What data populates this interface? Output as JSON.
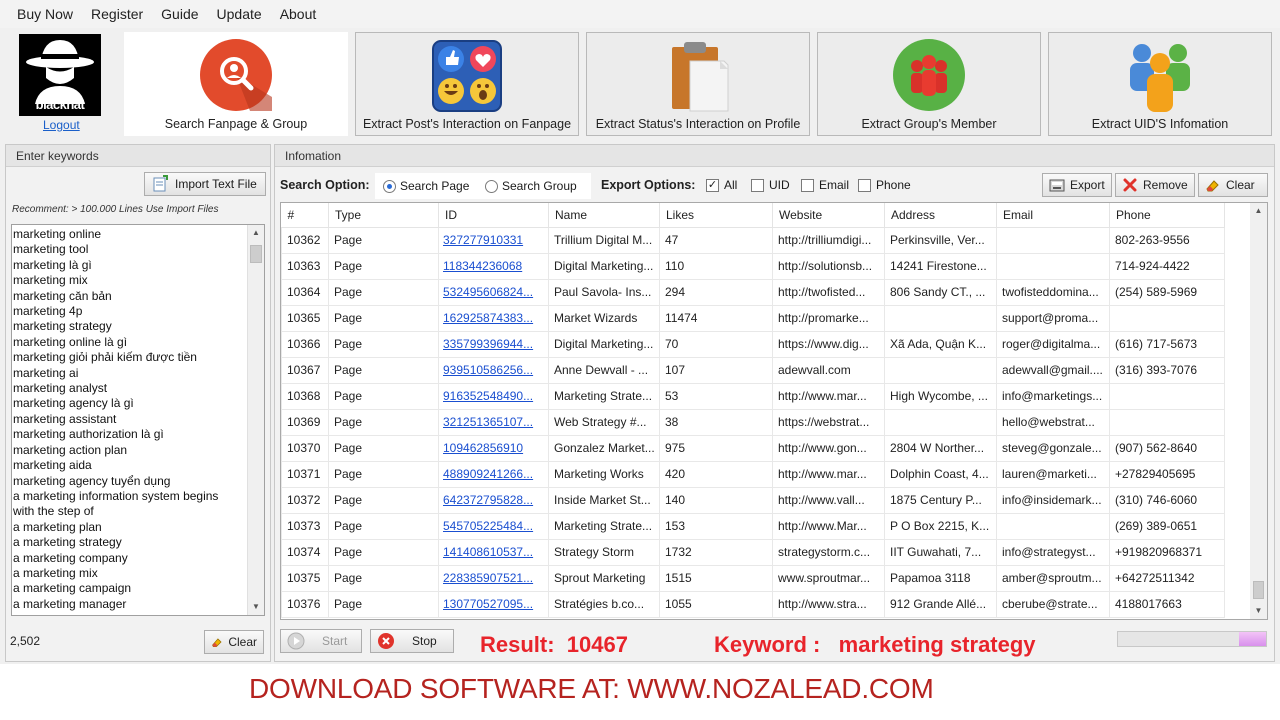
{
  "menu": [
    "Buy Now",
    "Register",
    "Guide",
    "Update",
    "About"
  ],
  "logo": {
    "text": "blackhat",
    "logout": "Logout"
  },
  "toolbar": [
    {
      "label": "Search Fanpage & Group",
      "icon": "search-user-icon",
      "active": true
    },
    {
      "label": "Extract Post's Interaction on Fanpage",
      "icon": "reactions-icon"
    },
    {
      "label": "Extract Status's Interaction on Profile",
      "icon": "clipboard-icon"
    },
    {
      "label": "Extract Group's Member",
      "icon": "group-icon"
    },
    {
      "label": "Extract UID'S  Infomation",
      "icon": "users-icon"
    }
  ],
  "left": {
    "title": "Enter keywords",
    "import_label": "Import Text File",
    "recommend": "Recomment: > 100.000 Lines Use Import Files",
    "keywords": [
      "marketing online",
      "marketing tool",
      "marketing là gì",
      "marketing mix",
      "marketing căn bản",
      "marketing 4p",
      "marketing strategy",
      "marketing online là gì",
      "marketing giỏi phải kiếm được tiền",
      "marketing ai",
      "marketing analyst",
      "marketing agency là gì",
      "marketing assistant",
      "marketing authorization là gì",
      "marketing action plan",
      "marketing aida",
      "marketing agency tuyển dụng",
      "a marketing information system begins",
      "with the step of",
      "a marketing plan",
      "a marketing strategy",
      "a marketing company",
      "a marketing mix",
      "a marketing campaign",
      "a marketing manager"
    ],
    "count": "2,502",
    "clear_label": "Clear"
  },
  "right": {
    "title": "Infomation",
    "search_option_label": "Search Option:",
    "search_page": "Search Page",
    "search_group": "Search Group",
    "export_options_label": "Export Options:",
    "export_checks": [
      {
        "label": "All",
        "checked": true
      },
      {
        "label": "UID",
        "checked": false
      },
      {
        "label": "Email",
        "checked": false
      },
      {
        "label": "Phone",
        "checked": false
      }
    ],
    "export_btn": "Export",
    "remove_btn": "Remove",
    "clear_btn": "Clear",
    "columns": [
      "#",
      "Type",
      "ID",
      "Name",
      "Likes",
      "Website",
      "Address",
      "Email",
      "Phone"
    ],
    "rows": [
      [
        "10362",
        "Page",
        "327277910331",
        "Trillium Digital  M...",
        "47",
        "http://trilliumdigi...",
        "Perkinsville, Ver...",
        "",
        "802-263-9556"
      ],
      [
        "10363",
        "Page",
        "118344236068",
        "Digital Marketing...",
        "110",
        "http://solutionsb...",
        "14241 Firestone...",
        "",
        "714-924-4422"
      ],
      [
        "10364",
        "Page",
        "532495606824...",
        "Paul Savola- Ins...",
        "294",
        "http://twofisted...",
        "806 Sandy CT., ...",
        "twofisteddomina...",
        "(254) 589-5969"
      ],
      [
        "10365",
        "Page",
        "162925874383...",
        "Market Wizards",
        "11474",
        "http://promarke...",
        "",
        "support@proma...",
        ""
      ],
      [
        "10366",
        "Page",
        "335799396944...",
        "Digital Marketing...",
        "70",
        "https://www.dig...",
        "Xã Ada, Quận K...",
        "roger@digitalma...",
        "(616) 717-5673"
      ],
      [
        "10367",
        "Page",
        "939510586256...",
        "Anne Dewvall - ...",
        "107",
        "adewvall.com",
        "",
        "adewvall@gmail....",
        "(316) 393-7076"
      ],
      [
        "10368",
        "Page",
        "916352548490...",
        "Marketing Strate...",
        "53",
        "http://www.mar...",
        "High Wycombe, ...",
        "info@marketings...",
        ""
      ],
      [
        "10369",
        "Page",
        "321251365107...",
        "Web Strategy #...",
        "38",
        "https://webstrat...",
        "",
        "hello@webstrat...",
        ""
      ],
      [
        "10370",
        "Page",
        "109462856910",
        "Gonzalez Market...",
        "975",
        "http://www.gon...",
        "2804 W Norther...",
        "steveg@gonzale...",
        "(907) 562-8640"
      ],
      [
        "10371",
        "Page",
        "488909241266...",
        "Marketing Works",
        "420",
        "http://www.mar...",
        "Dolphin Coast, 4...",
        "lauren@marketi...",
        "+27829405695"
      ],
      [
        "10372",
        "Page",
        "642372795828...",
        "Inside Market St...",
        "140",
        "http://www.vall...",
        "1875 Century P...",
        "info@insidemark...",
        "(310) 746-6060"
      ],
      [
        "10373",
        "Page",
        "545705225484...",
        "Marketing Strate...",
        "153",
        "http://www.Mar...",
        "P O Box 2215, K...",
        "",
        "(269) 389-0651"
      ],
      [
        "10374",
        "Page",
        "141408610537...",
        "Strategy Storm",
        "1732",
        "strategystorm.c...",
        "IIT Guwahati, 7...",
        "info@strategyst...",
        "+919820968371"
      ],
      [
        "10375",
        "Page",
        "228385907521...",
        "Sprout Marketing",
        "1515",
        "www.sproutmar...",
        "Papamoa 3118",
        "amber@sproutm...",
        "+64272511342"
      ],
      [
        "10376",
        "Page",
        "130770527095...",
        "Stratégies b.co...",
        "1055",
        "http://www.stra...",
        "912 Grande Allé...",
        "cberube@strate...",
        "4188017663"
      ]
    ],
    "start_btn": "Start",
    "stop_btn": "Stop",
    "result_text": "Result:  10467",
    "keyword_text": "Keyword :   marketing strategy",
    "progress": 0.18
  },
  "banner": "DOWNLOAD SOFTWARE AT: WWW.NOZALEAD.COM"
}
